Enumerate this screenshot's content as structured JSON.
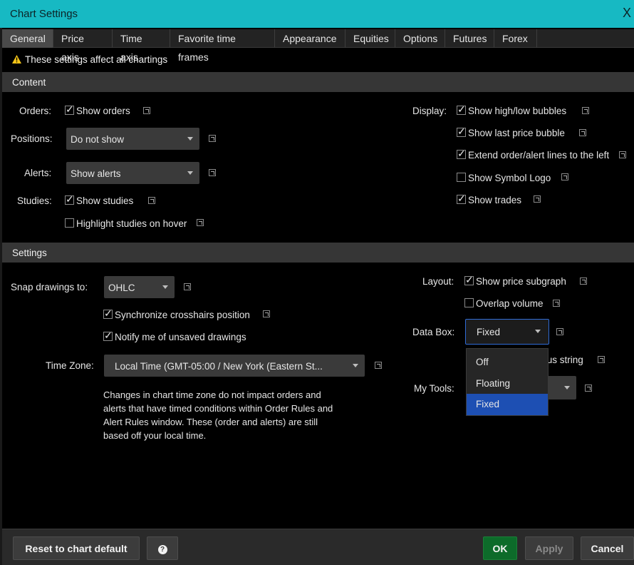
{
  "window": {
    "title": "Chart Settings",
    "close": "X"
  },
  "tabs": [
    "General",
    "Price axis",
    "Time axis",
    "Favorite time frames",
    "Appearance",
    "Equities",
    "Options",
    "Futures",
    "Forex"
  ],
  "warning": "These settings affect all chartings",
  "content": {
    "header": "Content",
    "orders_label": "Orders:",
    "show_orders": "Show orders",
    "positions_label": "Positions:",
    "positions_value": "Do not show",
    "alerts_label": "Alerts:",
    "alerts_value": "Show alerts",
    "studies_label": "Studies:",
    "show_studies": "Show studies",
    "highlight_studies": "Highlight studies on hover",
    "display_label": "Display:",
    "display_options": [
      {
        "label": "Show high/low bubbles",
        "checked": true
      },
      {
        "label": "Show last price bubble",
        "checked": true
      },
      {
        "label": "Extend order/alert lines to the left",
        "checked": true
      },
      {
        "label": "Show Symbol Logo",
        "checked": false
      },
      {
        "label": "Show trades",
        "checked": true
      }
    ]
  },
  "settings": {
    "header": "Settings",
    "snap_label": "Snap drawings to:",
    "snap_value": "OHLC",
    "sync_crosshairs": "Synchronize crosshairs position",
    "notify_unsaved": "Notify me of unsaved drawings",
    "timezone_label": "Time Zone:",
    "timezone_value": "Local Time (GMT-05:00 / New York (Eastern St...",
    "timezone_note": "Changes in chart time zone do not impact orders and alerts that have timed conditions within Order Rules and Alert Rules window. These (order and alerts) are still based off your local time.",
    "layout_label": "Layout:",
    "show_price_subgraph": "Show price subgraph",
    "overlap_volume": "Overlap volume",
    "databox_label": "Data Box:",
    "databox_value": "Fixed",
    "databox_options": [
      "Off",
      "Floating",
      "Fixed"
    ],
    "status_string_partial": "tus string",
    "mytools_label": "My Tools:"
  },
  "footer": {
    "reset": "Reset to chart default",
    "help": "?",
    "ok": "OK",
    "apply": "Apply",
    "cancel": "Cancel"
  },
  "colors": {
    "titlebar": "#17b9c3",
    "ok": "#0d6b2a",
    "selected": "#1d4fb3",
    "warning": "#f5c518"
  }
}
